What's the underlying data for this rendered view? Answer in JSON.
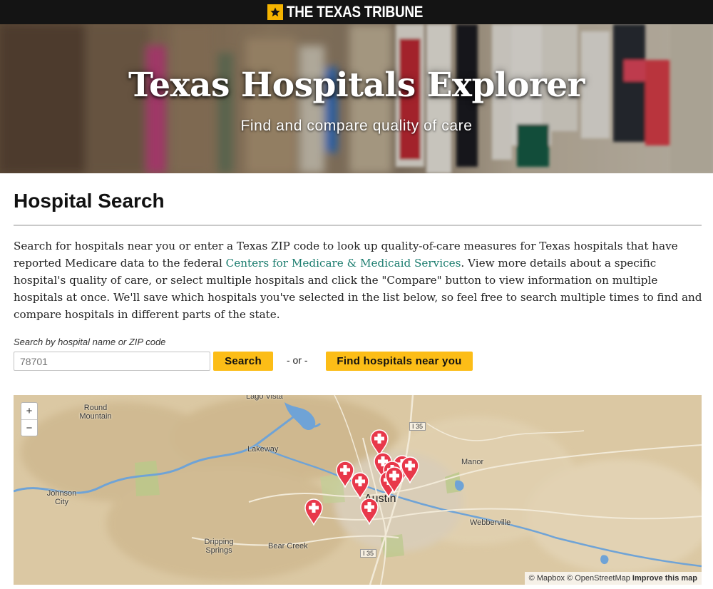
{
  "header": {
    "logo_text": "THE TEXAS TRIBUNE",
    "brand_color": "#f5b400"
  },
  "hero": {
    "title": "Texas Hospitals Explorer",
    "subtitle": "Find and compare quality of care"
  },
  "section": {
    "title": "Hospital Search",
    "intro_before": "Search for hospitals near you or enter a Texas ZIP code to look up quality-of-care measures for Texas hospitals that have reported Medicare data to the federal ",
    "intro_link": "Centers for Medicare & Medicaid Services",
    "intro_after": ". View more details about a specific hospital's quality of care, or select multiple hospitals and click the \"Compare\" button to view information on multiple hospitals at once. We'll save which hospitals you've selected in the list below, so feel free to search multiple times to find and compare hospitals in different parts of the state.",
    "link_color": "#1a7c6e"
  },
  "search": {
    "label": "Search by hospital name or ZIP code",
    "placeholder": "78701",
    "search_button": "Search",
    "or_text": "- or -",
    "near_button": "Find hospitals near you",
    "button_color": "#fcbd17"
  },
  "map": {
    "zoom_in": "+",
    "zoom_out": "−",
    "places": [
      "Lago Vista",
      "Round Mountain",
      "Lakeway",
      "Manor",
      "Johnson City",
      "Austin",
      "Webberville",
      "Dripping Springs",
      "Bear Creek"
    ],
    "highways": [
      "I 35",
      "I 35"
    ],
    "hospital_marker_icon": "hospital-cross-marker-icon",
    "marker_color": "#e8384a",
    "marker_count": 11,
    "attribution": {
      "mapbox": "© Mapbox",
      "osm": "© OpenStreetMap",
      "improve": "Improve this map"
    }
  }
}
